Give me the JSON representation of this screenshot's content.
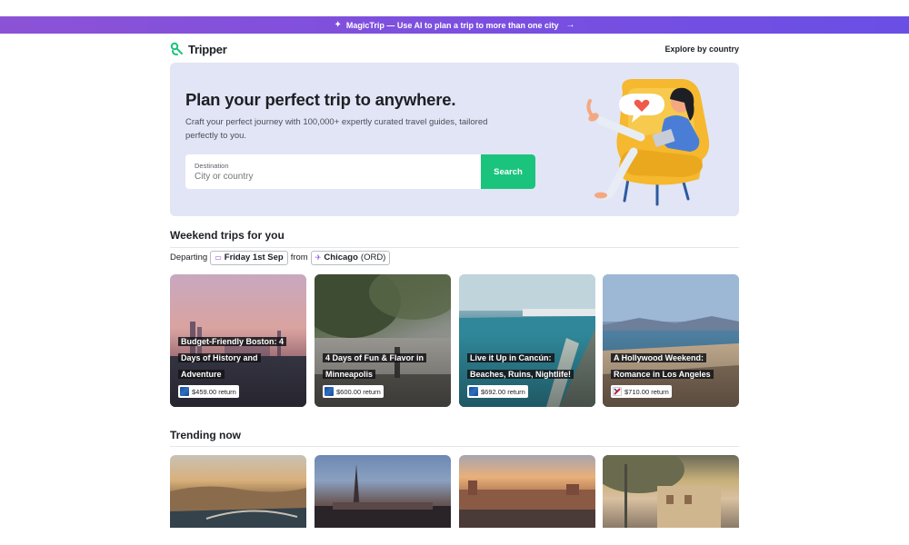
{
  "promo": {
    "sparkle_icon": "sparkle-icon",
    "text": "MagicTrip — Use AI to plan a trip to more than one city",
    "arrow": "→"
  },
  "header": {
    "logo_text": "Tripper",
    "explore_link": "Explore by country"
  },
  "hero": {
    "title": "Plan your perfect trip to anywhere.",
    "subtitle": "Craft your perfect journey with 100,000+ expertly curated travel guides, tailored perfectly to you.",
    "destination_label": "Destination",
    "destination_placeholder": "City or country",
    "search_button": "Search"
  },
  "weekend": {
    "title": "Weekend trips for you",
    "departing_label": "Departing",
    "date": "Friday 1st Sep",
    "from_label": "from",
    "origin_city": "Chicago",
    "origin_code": "(ORD)",
    "cards": [
      {
        "title": "Budget-Friendly Boston: 4 Days of History and Adventure",
        "price": "$459.00 return",
        "airline_icon": "united-airlines-icon"
      },
      {
        "title": "4 Days of Fun & Flavor in Minneapolis",
        "price": "$600.00 return",
        "airline_icon": "united-airlines-icon"
      },
      {
        "title": "Live it Up in Cancún: Beaches, Ruins, Nightlife!",
        "price": "$692.00 return",
        "airline_icon": "united-airlines-icon"
      },
      {
        "title": "A Hollywood Weekend: Romance in Los Angeles",
        "price": "$710.00 return",
        "airline_icon": "spirit-airlines-icon"
      }
    ]
  },
  "trending": {
    "title": "Trending now"
  },
  "colors": {
    "accent_green": "#1bc47d",
    "banner_purple": "#8c52d6",
    "hero_bg": "#e1e5f5",
    "chair_yellow": "#f5b82e"
  }
}
